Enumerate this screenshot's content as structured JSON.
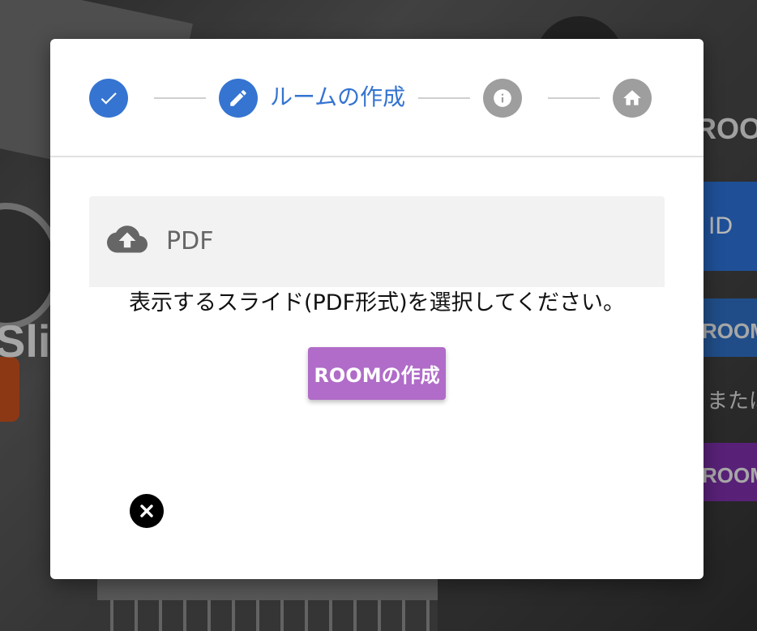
{
  "background": {
    "slide_text": "Slid",
    "room_heading": "ROOM",
    "id_button_label": "ID",
    "room_button_1_label": "ROOMに",
    "or_text": "または",
    "room_button_2_label": "ROOMの",
    "colors": {
      "blue_button": "#2c6fd1",
      "purple_button": "#7a2ea6"
    }
  },
  "stepper": {
    "steps": [
      {
        "icon": "check-icon",
        "state": "completed"
      },
      {
        "icon": "pencil-icon",
        "state": "active",
        "label": "ルームの作成"
      },
      {
        "icon": "info-icon",
        "state": "inactive"
      },
      {
        "icon": "home-icon",
        "state": "inactive"
      }
    ],
    "colors": {
      "active": "#3574d1",
      "inactive": "#9e9e9e"
    }
  },
  "upload": {
    "icon": "cloud-upload-icon",
    "label": "PDF"
  },
  "instruction": "表示するスライド(PDF形式)を選択してください。",
  "create_button": {
    "label": "ROOMの作成",
    "color": "#b06cc8"
  },
  "close_button": {
    "icon": "close-icon"
  }
}
